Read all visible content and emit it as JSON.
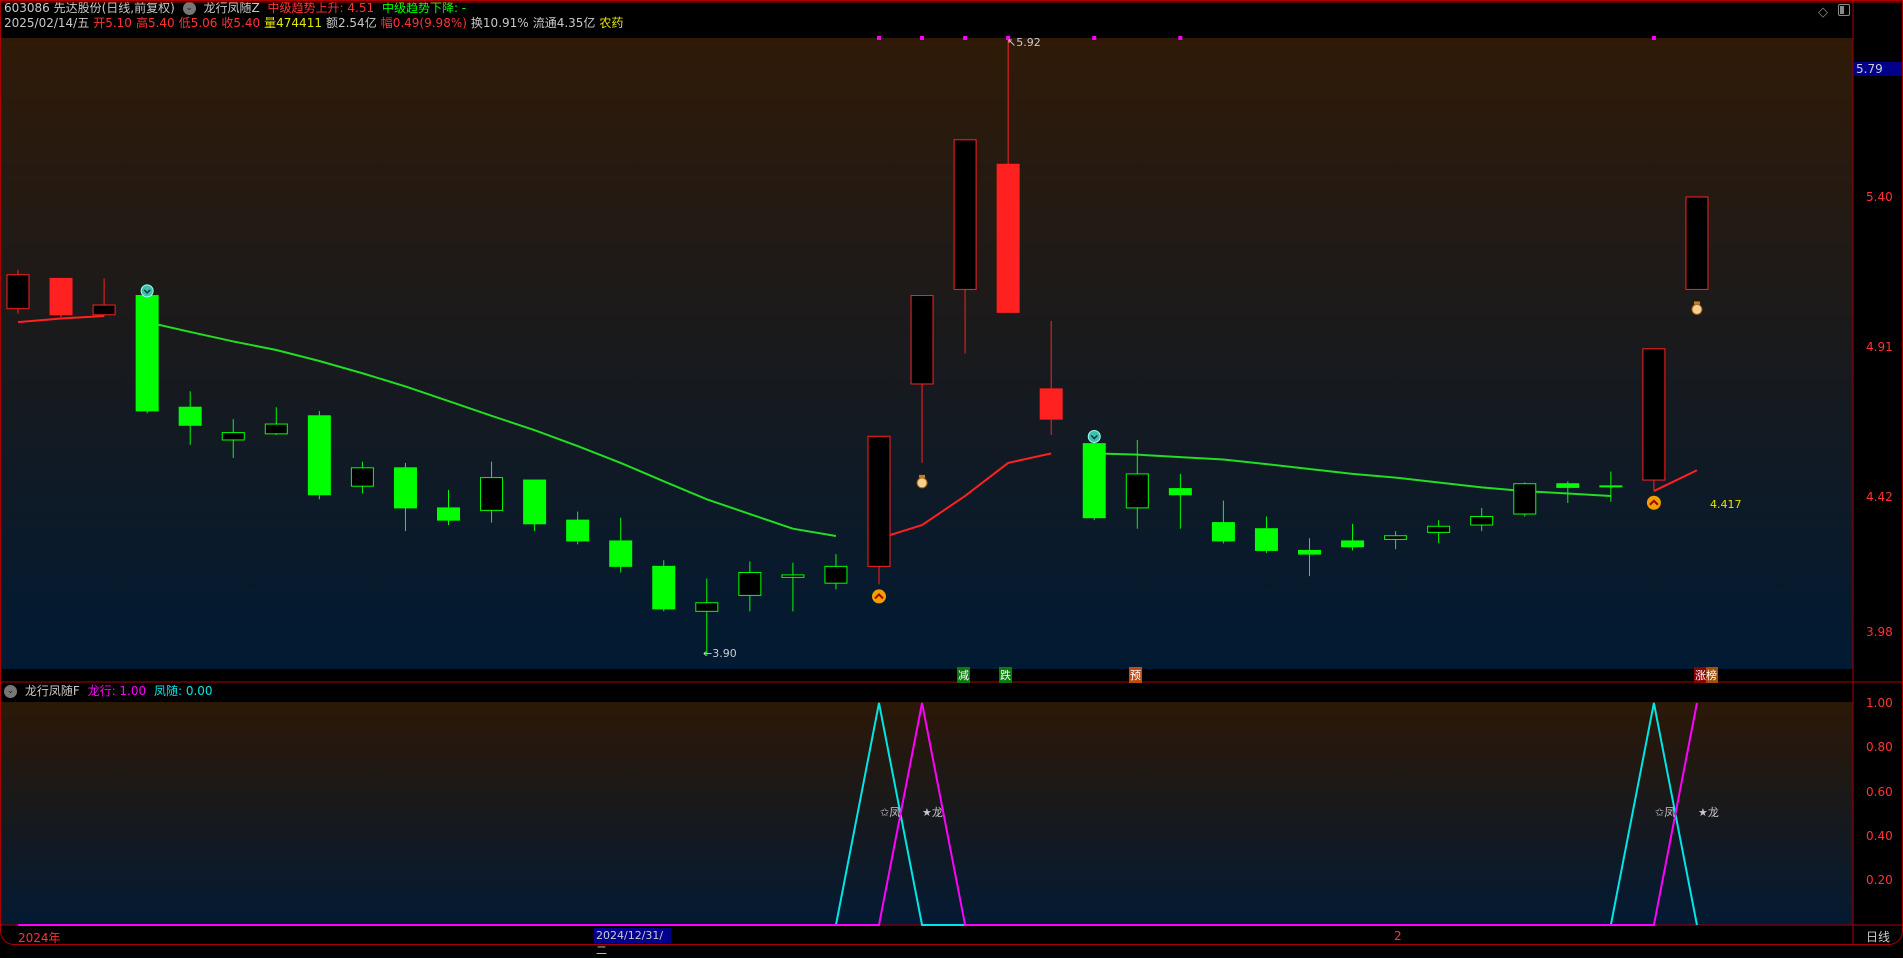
{
  "header": {
    "code_name": "603086 先达股份(日线,前复权)",
    "indicator": "龙行凤随Z",
    "trend_up": "中级趋势上升: 4.51",
    "trend_down": "中级趋势下降: -",
    "date": "2025/02/14/五",
    "open": "开5.10",
    "high": "高5.40",
    "low": "低5.06",
    "close": "收5.40",
    "volume": "量474411",
    "amount": "额2.54亿",
    "change": "幅0.49(9.98%)",
    "turnover": "换10.91%",
    "float": "流通4.35亿",
    "sector": "农药"
  },
  "lower_header": {
    "name": "龙行凤随F",
    "long": "龙行: 1.00",
    "feng": "凤随: 0.00"
  },
  "axis": {
    "current": "5.79",
    "ticks": [
      "5.40",
      "4.91",
      "4.42",
      "3.98"
    ],
    "lower_ticks": [
      "1.00",
      "0.80",
      "0.60",
      "0.40",
      "0.20"
    ],
    "period": "日线"
  },
  "time_axis": {
    "year": "2024年",
    "cursor": "2024/12/31/二",
    "month": "2"
  },
  "annotations": {
    "high": "5.92",
    "low": "3.90",
    "last_ma": "4.417",
    "feng_mark": "✩凤",
    "long_mark": "★龙"
  },
  "signals": [
    "减",
    "跌",
    "预",
    "涨榜"
  ],
  "colors": {
    "up": "#ff2020",
    "down": "#00ff00",
    "ma_up": "#ff2020",
    "ma_down": "#22dd22",
    "feng": "#00e5e5",
    "long": "#ff00ff"
  },
  "chart_data": {
    "type": "candlestick",
    "candles": [
      {
        "o": 5.035,
        "c": 5.146,
        "h": 5.162,
        "l": 5.019,
        "t": "r"
      },
      {
        "o": 5.134,
        "c": 5.015,
        "h": 5.134,
        "l": 5.007,
        "t": "r"
      },
      {
        "o": 5.015,
        "c": 5.047,
        "h": 5.134,
        "l": 5.011,
        "t": "r"
      },
      {
        "o": 5.078,
        "c": 4.701,
        "h": 5.09,
        "l": 4.693,
        "t": "g"
      },
      {
        "o": 4.713,
        "c": 4.654,
        "h": 4.765,
        "l": 4.59,
        "t": "g"
      },
      {
        "o": 4.606,
        "c": 4.63,
        "h": 4.674,
        "l": 4.547,
        "t": "g"
      },
      {
        "o": 4.626,
        "c": 4.658,
        "h": 4.713,
        "l": 4.622,
        "t": "g"
      },
      {
        "o": 4.685,
        "c": 4.427,
        "h": 4.701,
        "l": 4.412,
        "t": "g"
      },
      {
        "o": 4.455,
        "c": 4.515,
        "h": 4.535,
        "l": 4.431,
        "t": "g"
      },
      {
        "o": 4.515,
        "c": 4.384,
        "h": 4.531,
        "l": 4.308,
        "t": "g"
      },
      {
        "o": 4.384,
        "c": 4.344,
        "h": 4.443,
        "l": 4.328,
        "t": "g"
      },
      {
        "o": 4.376,
        "c": 4.483,
        "h": 4.535,
        "l": 4.336,
        "t": "g"
      },
      {
        "o": 4.475,
        "c": 4.332,
        "h": 4.475,
        "l": 4.308,
        "t": "g"
      },
      {
        "o": 4.344,
        "c": 4.276,
        "h": 4.372,
        "l": 4.265,
        "t": "g"
      },
      {
        "o": 4.276,
        "c": 4.193,
        "h": 4.352,
        "l": 4.173,
        "t": "g"
      },
      {
        "o": 4.193,
        "c": 4.054,
        "h": 4.213,
        "l": 4.046,
        "t": "g"
      },
      {
        "o": 4.046,
        "c": 4.074,
        "h": 4.153,
        "l": 3.9,
        "t": "g"
      },
      {
        "o": 4.098,
        "c": 4.173,
        "h": 4.209,
        "l": 4.046,
        "t": "g"
      },
      {
        "o": 4.157,
        "c": 4.165,
        "h": 4.205,
        "l": 4.046,
        "t": "g"
      },
      {
        "o": 4.138,
        "c": 4.193,
        "h": 4.233,
        "l": 4.118,
        "t": "g"
      },
      {
        "o": 4.193,
        "c": 4.618,
        "h": 4.618,
        "l": 4.134,
        "t": "r"
      },
      {
        "o": 4.789,
        "c": 5.078,
        "h": 5.078,
        "l": 4.531,
        "t": "r"
      },
      {
        "o": 5.098,
        "c": 5.587,
        "h": 5.587,
        "l": 4.888,
        "t": "r"
      },
      {
        "o": 5.507,
        "c": 5.023,
        "h": 5.92,
        "l": 5.023,
        "t": "r"
      },
      {
        "o": 4.773,
        "c": 4.674,
        "h": 4.995,
        "l": 4.622,
        "t": "r"
      },
      {
        "o": 4.594,
        "c": 4.352,
        "h": 4.614,
        "l": 4.344,
        "t": "g"
      },
      {
        "o": 4.384,
        "c": 4.495,
        "h": 4.606,
        "l": 4.316,
        "t": "g"
      },
      {
        "o": 4.447,
        "c": 4.427,
        "h": 4.495,
        "l": 4.316,
        "t": "g"
      },
      {
        "o": 4.336,
        "c": 4.276,
        "h": 4.408,
        "l": 4.268,
        "t": "g"
      },
      {
        "o": 4.316,
        "c": 4.245,
        "h": 4.356,
        "l": 4.237,
        "t": "g"
      },
      {
        "o": 4.245,
        "c": 4.233,
        "h": 4.285,
        "l": 4.161,
        "t": "g"
      },
      {
        "o": 4.276,
        "c": 4.257,
        "h": 4.332,
        "l": 4.245,
        "t": "g"
      },
      {
        "o": 4.281,
        "c": 4.293,
        "h": 4.308,
        "l": 4.249,
        "t": "g"
      },
      {
        "o": 4.304,
        "c": 4.324,
        "h": 4.344,
        "l": 4.269,
        "t": "g"
      },
      {
        "o": 4.328,
        "c": 4.356,
        "h": 4.384,
        "l": 4.308,
        "t": "g"
      },
      {
        "o": 4.364,
        "c": 4.463,
        "h": 4.467,
        "l": 4.356,
        "t": "g"
      },
      {
        "o": 4.463,
        "c": 4.451,
        "h": 4.471,
        "l": 4.4,
        "t": "g"
      },
      {
        "o": 4.455,
        "c": 4.456,
        "h": 4.503,
        "l": 4.404,
        "t": "g"
      },
      {
        "o": 4.475,
        "c": 4.904,
        "h": 4.904,
        "l": 4.44,
        "t": "r"
      },
      {
        "o": 5.098,
        "c": 5.4,
        "h": 5.4,
        "l": 5.098,
        "t": "r"
      }
    ],
    "ma_segments": [
      {
        "trend": "up",
        "start": 0,
        "values": [
          4.991,
          5.003,
          5.011
        ]
      },
      {
        "trend": "down",
        "start": 3,
        "values": [
          4.991,
          4.959,
          4.928,
          4.9,
          4.864,
          4.824,
          4.781,
          4.733,
          4.685,
          4.638,
          4.586,
          4.531,
          4.471,
          4.412,
          4.364,
          4.316,
          4.292
        ]
      },
      {
        "trend": "up",
        "start": 20,
        "values": [
          4.284,
          4.328,
          4.423,
          4.531,
          4.562
        ]
      },
      {
        "trend": "down",
        "start": 25,
        "values": [
          4.562,
          4.558,
          4.55,
          4.542,
          4.527,
          4.511,
          4.495,
          4.483,
          4.467,
          4.451,
          4.439,
          4.431,
          4.423
        ]
      },
      {
        "trend": "up",
        "start": 38,
        "values": [
          4.439,
          4.507
        ]
      }
    ],
    "sell_marks": [
      3,
      25
    ],
    "buy_marks": [
      20,
      38
    ],
    "bag_marks": [
      21,
      39
    ],
    "top_dots": [
      20,
      21,
      22,
      23,
      25,
      27,
      38
    ],
    "signal_idx": [
      22,
      23,
      26,
      39
    ],
    "feng": {
      "peaks": [
        20,
        38
      ]
    },
    "long": {
      "peaks": [
        21,
        39
      ]
    },
    "ylim": [
      3.82,
      5.96
    ],
    "lower_ylim": [
      0,
      1.07
    ]
  }
}
